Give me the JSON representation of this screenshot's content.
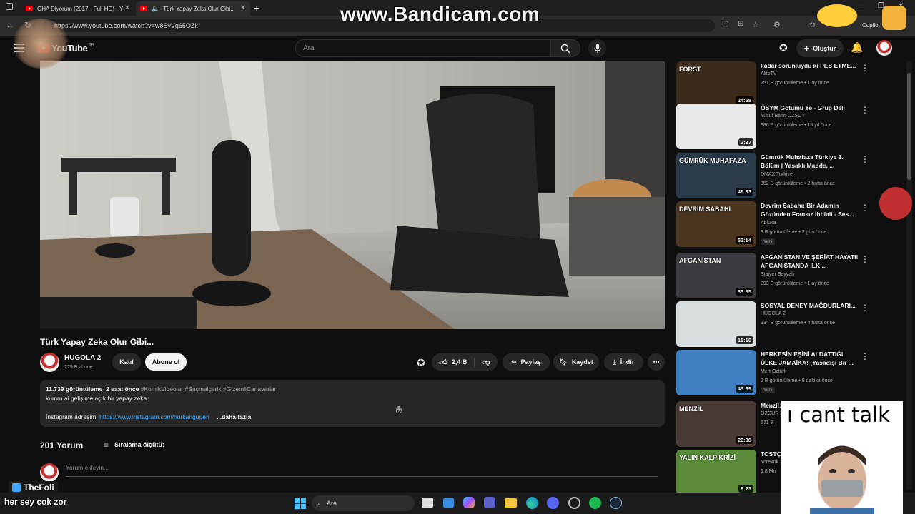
{
  "browser": {
    "tabs": [
      {
        "title": "OHA Diyorum (2017 - Full HD) - Y",
        "active": false
      },
      {
        "title": "Türk Yapay Zeka Olur Gibi...",
        "active": true
      }
    ],
    "url": "https://www.youtube.com/watch?v=w8SyVg65OZk",
    "copilot_label": "Copilot"
  },
  "youtube": {
    "logo_text": "YouTube",
    "logo_country": "TR",
    "search_placeholder": "Ara",
    "create_label": "Oluştur"
  },
  "video": {
    "title": "Türk Yapay Zeka Olur Gibi...",
    "channel": "HUGOLA 2",
    "subscribers": "225 B abone",
    "join_label": "Katıl",
    "subscribe_label": "Abone ol",
    "likes": "2,4 B",
    "share_label": "Paylaş",
    "save_label": "Kaydet",
    "download_label": "İndir",
    "views_time": "11.739 görüntüleme  2 saat önce",
    "hashtags": "#KomikVideolar #Saçmalçerik #GizemliCanavarlar",
    "description_line": "kumru ai gelişime açık bir yapay zeka",
    "instagram_label": "İnstagram adresim:",
    "instagram_url": "https://www.instagram.com/hurkangugen",
    "more_label": "...daha fazla"
  },
  "comments": {
    "count_label": "201 Yorum",
    "sort_label": "Sıralama ölçütü:",
    "add_placeholder": "Yorum ekleyin..."
  },
  "sidebar": {
    "items": [
      {
        "title": "kadar sorunluydu ki PES ETME...",
        "channel": "AlitoTV",
        "meta": "251 B görüntüleme • 1 ay önce",
        "duration": "24:58",
        "badge": "",
        "thumb_color": "#3b2a1a",
        "thumb_text": "FORST"
      },
      {
        "title": "ÖSYM Götümü Ye - Grup Deli",
        "channel": "Yusuf Bahri ÖZSOY",
        "meta": "686 B görüntüleme • 18 yıl önce",
        "duration": "2:37",
        "badge": "",
        "thumb_color": "#e8e8e8",
        "thumb_text": ""
      },
      {
        "title": "Gümrük Muhafaza Türkiye 1. Bölüm | Yasaklı Madde, ...",
        "channel": "DMAX Turkiye",
        "meta": "352 B görüntüleme • 2 hafta önce",
        "duration": "48:33",
        "badge": "",
        "thumb_color": "#2a3a4a",
        "thumb_text": "GÜMRÜK MUHAFAZA"
      },
      {
        "title": "Devrim Sabahı: Bir Adamın Gözünden Fransız İhtilali - Ses...",
        "channel": "Abluka",
        "meta": "3 B görüntüleme • 2 gün önce",
        "duration": "52:14",
        "badge": "Yeni",
        "thumb_color": "#4a3520",
        "thumb_text": "DEVRİM SABAHI"
      },
      {
        "title": "AFGANİSTAN VE ŞERİAT HAYATI! AFGANİSTANDA İLK ...",
        "channel": "Stajyer Seyyah",
        "meta": "293 B görüntüleme • 1 ay önce",
        "duration": "33:35",
        "badge": "",
        "thumb_color": "#3a3a40",
        "thumb_text": "AFGANİSTAN"
      },
      {
        "title": "SOSYAL DENEY MAĞDURLARI...",
        "channel": "HUGOLA 2",
        "meta": "334 B görüntüleme • 4 hafta önce",
        "duration": "15:10",
        "badge": "",
        "thumb_color": "#d8dde0",
        "thumb_text": ""
      },
      {
        "title": "HERKESİN EŞİNİ ALDATTIĞI ÜLKE JAMAİKA! (Yasadışı Bir ...",
        "channel": "Mert Öztürk",
        "meta": "2 B görüntüleme • 8 dakika önce",
        "duration": "43:39",
        "badge": "Yeni",
        "thumb_color": "#3f7fbf",
        "thumb_text": ""
      },
      {
        "title": "Menzil: Tarikatı",
        "channel": "ÖZGÜR X",
        "meta": "671 B",
        "duration": "29:08",
        "badge": "",
        "thumb_color": "#4a3a36",
        "thumb_text": "MENZİL"
      },
      {
        "title": "TOSTÇ FABRİK",
        "channel": "Yorekok",
        "meta": "1,8 Mn",
        "duration": "8:23",
        "badge": "",
        "thumb_color": "#5a8a3a",
        "thumb_text": "YALIN KALP KRİZİ"
      }
    ]
  },
  "overlays": {
    "watermark": "www.Bandicam.com",
    "meme_text": "ı cant talk",
    "streamer_name": "TheFoli",
    "subtitle": "her sey cok zor"
  },
  "taskbar": {
    "search_label": "Ara"
  }
}
